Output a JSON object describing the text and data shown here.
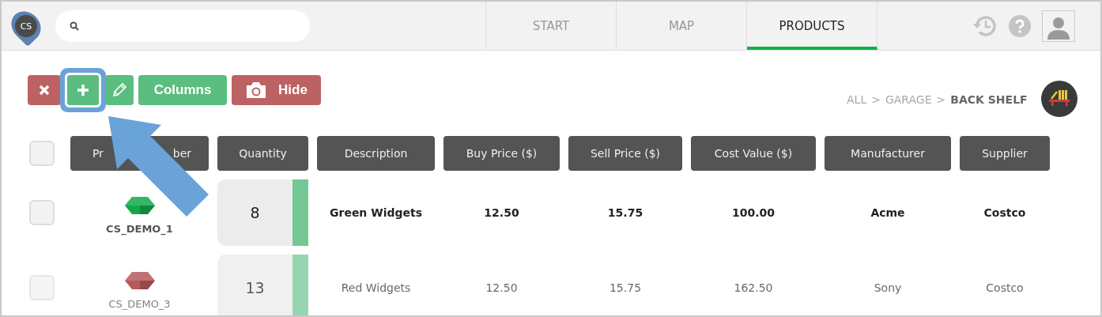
{
  "header": {
    "logo": "CS",
    "tabs": [
      {
        "label": "START",
        "selected": false
      },
      {
        "label": "MAP",
        "selected": false
      },
      {
        "label": "PRODUCTS",
        "selected": true
      }
    ]
  },
  "toolbar": [
    {
      "kind": "delete",
      "highlighted": false
    },
    {
      "kind": "add",
      "highlighted": true
    },
    {
      "kind": "edit",
      "highlighted": false
    },
    {
      "kind": "columns",
      "label": "Columns",
      "highlighted": false
    },
    {
      "kind": "hide",
      "label": "Hide",
      "highlighted": false
    }
  ],
  "breadcrumb": [
    {
      "kind": "link",
      "label": "ALL",
      "current": false
    },
    {
      "kind": "separator",
      "label": ">"
    },
    {
      "kind": "link",
      "label": "GARAGE",
      "current": false
    },
    {
      "kind": "separator",
      "label": ">"
    },
    {
      "kind": "link",
      "label": "BACK SHELF",
      "current": true
    }
  ],
  "table": {
    "select_all": {
      "checked": false
    },
    "columns": [
      {
        "parts": [
          "Pr",
          "ber"
        ]
      },
      "Quantity",
      "Description",
      "Buy Price ($)",
      "Sell Price ($)",
      "Cost Value ($)",
      "Manufacturer",
      "Supplier"
    ],
    "rows": [
      {
        "checked": false,
        "emphasized": true,
        "color": "#12a84a",
        "product_number": "CS_DEMO_1",
        "quantity": "8",
        "description": "Green Widgets",
        "buy_price": "12.50",
        "sell_price": "15.75",
        "cost_value": "100.00",
        "manufacturer": "Acme",
        "supplier": "Costco"
      },
      {
        "checked": false,
        "emphasized": false,
        "color": "#b85a5a",
        "product_number": "CS_DEMO_3",
        "quantity": "13",
        "description": "Red Widgets",
        "buy_price": "12.50",
        "sell_price": "15.75",
        "cost_value": "162.50",
        "manufacturer": "Sony",
        "supplier": "Costco"
      }
    ]
  }
}
